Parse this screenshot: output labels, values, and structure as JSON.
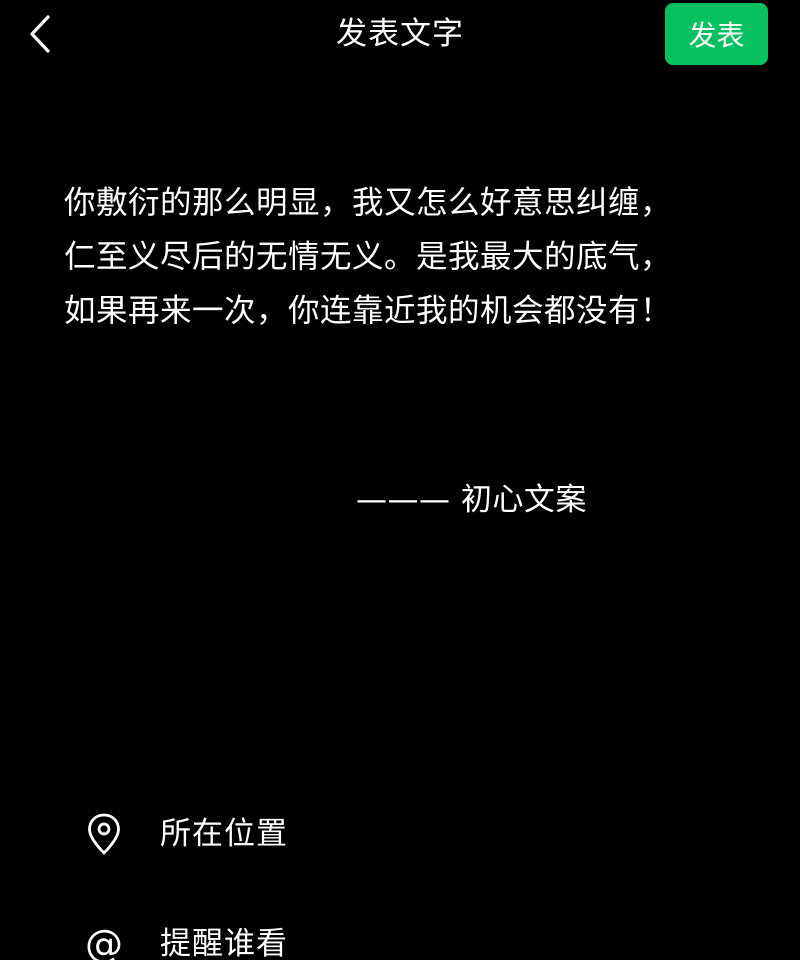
{
  "header": {
    "back_icon": "chevron-left-icon",
    "title": "发表文字",
    "publish_label": "发表",
    "publish_color": "#07c160"
  },
  "post": {
    "lines": [
      "你敷衍的那么明显，我又怎么好意思纠缠，",
      "仁至义尽后的无情无义。是我最大的底气，",
      "如果再来一次，你连靠近我的机会都没有！"
    ],
    "signature": "——— 初心文案"
  },
  "options": {
    "location": {
      "icon": "location-pin-icon",
      "label": "所在位置"
    },
    "mention": {
      "icon": "at-icon",
      "icon_glyph": "@",
      "label": "提醒谁看"
    }
  },
  "theme": {
    "background": "#000000",
    "text": "#ffffff"
  }
}
